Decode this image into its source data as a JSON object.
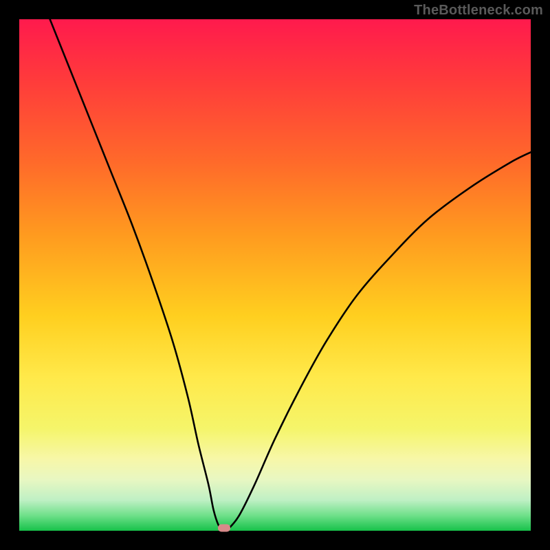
{
  "watermark": "TheBottleneck.com",
  "chart_data": {
    "type": "line",
    "title": "",
    "xlabel": "",
    "ylabel": "",
    "xlim": [
      0,
      100
    ],
    "ylim": [
      0,
      100
    ],
    "grid": false,
    "series": [
      {
        "name": "bottleneck-curve",
        "x": [
          6,
          10,
          14,
          18,
          22,
          26,
          30,
          33,
          35,
          37,
          38,
          39,
          40,
          41,
          43,
          46,
          50,
          55,
          60,
          66,
          73,
          80,
          88,
          96,
          100
        ],
        "y": [
          100,
          90,
          80,
          70,
          60,
          49,
          37,
          26,
          17,
          9,
          4,
          1,
          0,
          0.5,
          3,
          9,
          18,
          28,
          37,
          46,
          54,
          61,
          67,
          72,
          74
        ]
      }
    ],
    "annotations": [
      {
        "name": "optimum-marker",
        "x": 40,
        "y": 0.5
      }
    ],
    "background_gradient": {
      "top": "#ff1a4d",
      "mid": "#ffe94a",
      "bottom": "#17c24a"
    }
  }
}
